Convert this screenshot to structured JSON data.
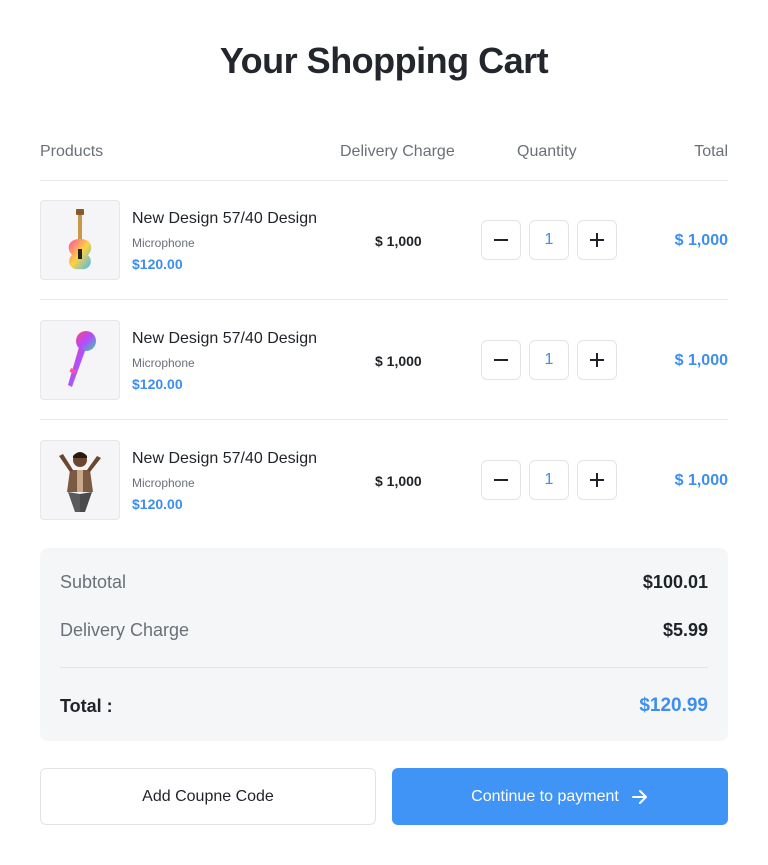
{
  "page": {
    "title": "Your Shopping Cart"
  },
  "table": {
    "headers": {
      "products": "Products",
      "delivery": "Delivery Charge",
      "quantity": "Quantity",
      "total": "Total"
    },
    "rows": [
      {
        "name": "New Design 57/40 Design",
        "category": "Microphone",
        "price": "$120.00",
        "delivery": "$ 1,000",
        "quantity": "1",
        "total": "$ 1,000",
        "image": "guitar-image"
      },
      {
        "name": "New Design 57/40 Design",
        "category": "Microphone",
        "price": "$120.00",
        "delivery": "$ 1,000",
        "quantity": "1",
        "total": "$ 1,000",
        "image": "microphone-image"
      },
      {
        "name": "New Design 57/40 Design",
        "category": "Microphone",
        "price": "$120.00",
        "delivery": "$ 1,000",
        "quantity": "1",
        "total": "$ 1,000",
        "image": "singer-image"
      }
    ]
  },
  "summary": {
    "subtotal_label": "Subtotal",
    "subtotal_value": "$100.01",
    "delivery_label": "Delivery Charge",
    "delivery_value": "$5.99",
    "total_label": "Total :",
    "total_value": "$120.99"
  },
  "actions": {
    "coupon_label": "Add Coupne Code",
    "pay_label": "Continue to payment"
  },
  "colors": {
    "accent": "#3d8ef0",
    "button_primary": "#4094f5",
    "summary_bg": "#f5f6f8"
  }
}
